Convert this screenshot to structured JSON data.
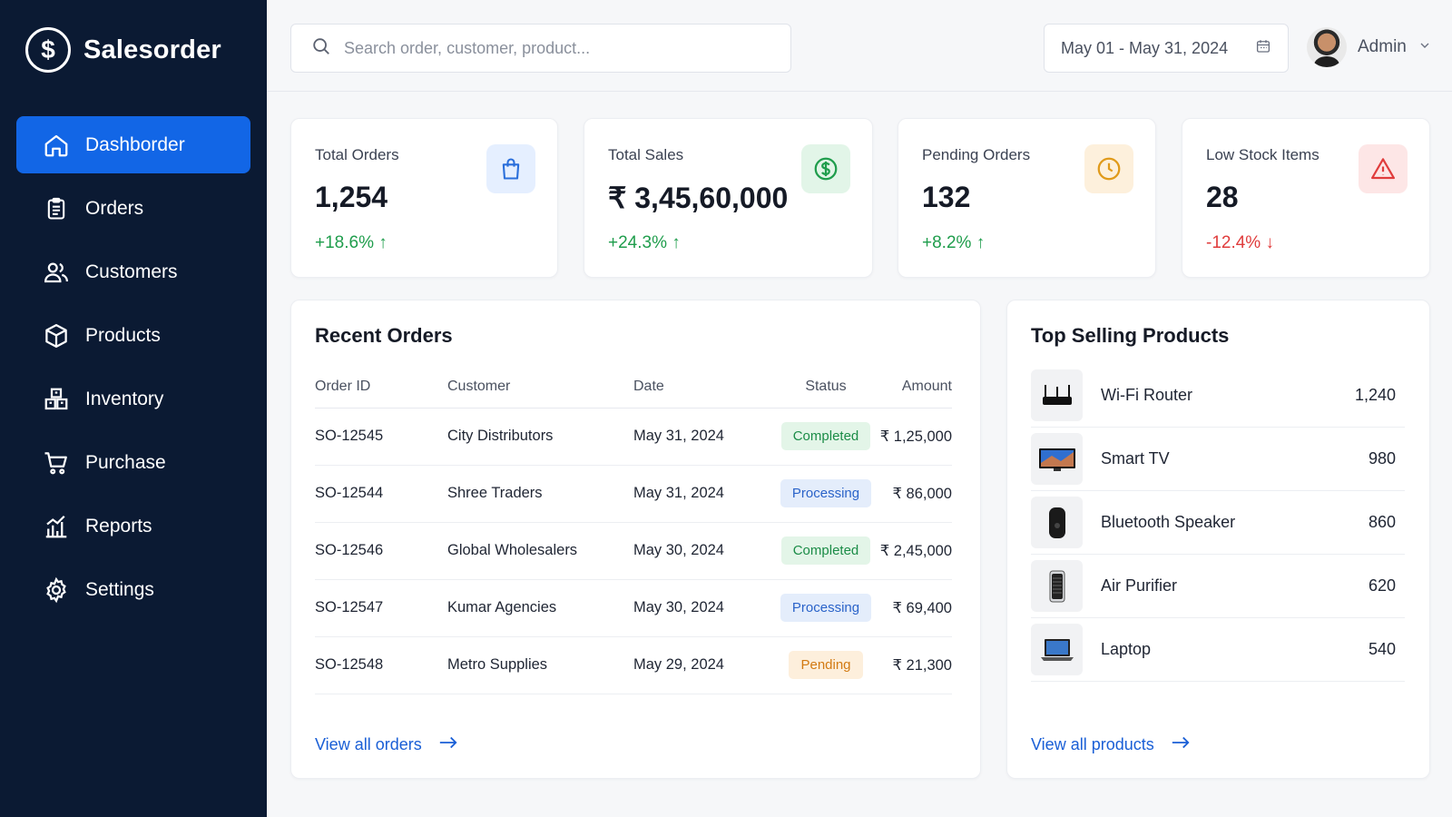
{
  "app": {
    "name": "Salesorder",
    "logo_glyph": "$"
  },
  "sidebar": {
    "items": [
      {
        "label": "Dashborder",
        "icon": "home-icon",
        "active": true
      },
      {
        "label": "Orders",
        "icon": "clipboard-icon",
        "active": false
      },
      {
        "label": "Customers",
        "icon": "users-icon",
        "active": false
      },
      {
        "label": "Products",
        "icon": "box-icon",
        "active": false
      },
      {
        "label": "Inventory",
        "icon": "inventory-icon",
        "active": false
      },
      {
        "label": "Purchase",
        "icon": "cart-icon",
        "active": false
      },
      {
        "label": "Reports",
        "icon": "chart-icon",
        "active": false
      },
      {
        "label": "Settings",
        "icon": "gear-icon",
        "active": false
      }
    ]
  },
  "header": {
    "search_placeholder": "Search order, customer, product...",
    "date_range": "May 01 - May 31, 2024",
    "user_name": "Admin"
  },
  "stats": [
    {
      "title": "Total Orders",
      "value": "1,254",
      "change": "+18.6%",
      "trend": "up",
      "icon": "shopping-bag-icon",
      "icon_bg": "#e5efff",
      "icon_color": "#2a6fdb"
    },
    {
      "title": "Total Sales",
      "value": "₹ 3,45,60,000",
      "change": "+24.3%",
      "trend": "up",
      "icon": "dollar-circle-icon",
      "icon_bg": "#e2f5e8",
      "icon_color": "#1f9d4c"
    },
    {
      "title": "Pending Orders",
      "value": "132",
      "change": "+8.2%",
      "trend": "up",
      "icon": "clock-icon",
      "icon_bg": "#fdf0dc",
      "icon_color": "#e09a1a"
    },
    {
      "title": "Low Stock Items",
      "value": "28",
      "change": "-12.4%",
      "trend": "down",
      "icon": "warning-icon",
      "icon_bg": "#fde6e6",
      "icon_color": "#e03c3c"
    }
  ],
  "recent_orders": {
    "title": "Recent Orders",
    "columns": [
      "Order ID",
      "Customer",
      "Date",
      "Status",
      "Amount"
    ],
    "rows": [
      {
        "id": "SO-12545",
        "customer": "City Distributors",
        "date": "May 31, 2024",
        "status": "Completed",
        "amount": "₹ 1,25,000"
      },
      {
        "id": "SO-12544",
        "customer": "Shree Traders",
        "date": "May 31, 2024",
        "status": "Processing",
        "amount": "₹ 86,000"
      },
      {
        "id": "SO-12546",
        "customer": "Global Wholesalers",
        "date": "May 30, 2024",
        "status": "Completed",
        "amount": "₹ 2,45,000"
      },
      {
        "id": "SO-12547",
        "customer": "Kumar Agencies",
        "date": "May 30, 2024",
        "status": "Processing",
        "amount": "₹ 69,400"
      },
      {
        "id": "SO-12548",
        "customer": "Metro Supplies",
        "date": "May 29, 2024",
        "status": "Pending",
        "amount": "₹ 21,300"
      }
    ],
    "view_all": "View all orders"
  },
  "top_products": {
    "title": "Top Selling Products",
    "items": [
      {
        "name": "Wi-Fi Router",
        "count": "1,240",
        "icon": "router-icon"
      },
      {
        "name": "Smart TV",
        "count": "980",
        "icon": "tv-icon"
      },
      {
        "name": "Bluetooth Speaker",
        "count": "860",
        "icon": "speaker-icon"
      },
      {
        "name": "Air Purifier",
        "count": "620",
        "icon": "air-purifier-icon"
      },
      {
        "name": "Laptop",
        "count": "540",
        "icon": "laptop-icon"
      }
    ],
    "view_all": "View all products"
  },
  "colors": {
    "sidebar_bg": "#0b1a33",
    "accent": "#1266e6",
    "up": "#1f9d4c",
    "down": "#e03c3c"
  }
}
